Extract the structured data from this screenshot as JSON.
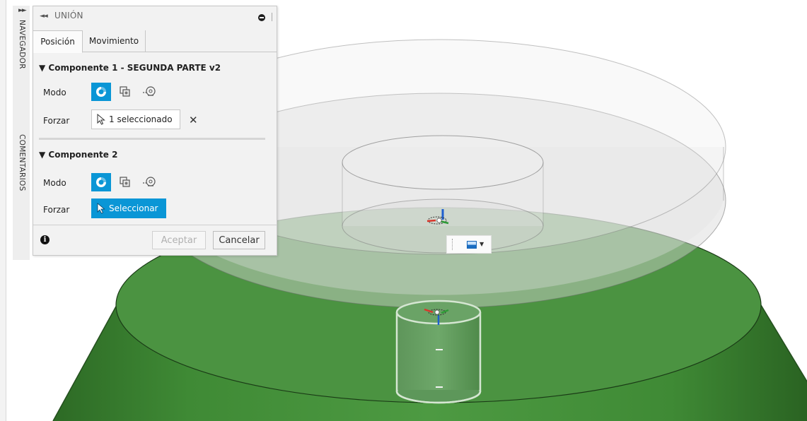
{
  "sidebar": {
    "expand_glyph": "►►",
    "navigator_label": "NAVEGADOR",
    "comments_label": "COMENTARIOS"
  },
  "dialog": {
    "title": "UNIÓN",
    "collapse_glyph": "◄◄",
    "tabs": [
      {
        "label": "Posición",
        "active": true
      },
      {
        "label": "Movimiento",
        "active": false
      }
    ],
    "component1": {
      "header": "▼ Componente 1 - SEGUNDA PARTE v2",
      "mode_label": "Modo",
      "force_label": "Forzar",
      "force_value": "1 seleccionado",
      "clear_glyph": "✕"
    },
    "component2": {
      "header": "▼ Componente 2",
      "mode_label": "Modo",
      "force_label": "Forzar",
      "force_value": "Seleccionar"
    },
    "info_glyph": "i",
    "ok_label": "Aceptar",
    "cancel_label": "Cancelar"
  },
  "view_control": {
    "caret": "▼"
  },
  "colors": {
    "accent_blue": "#0a96d6",
    "part_green": "#3d8a34",
    "panel_bg": "#f2f2f2"
  }
}
